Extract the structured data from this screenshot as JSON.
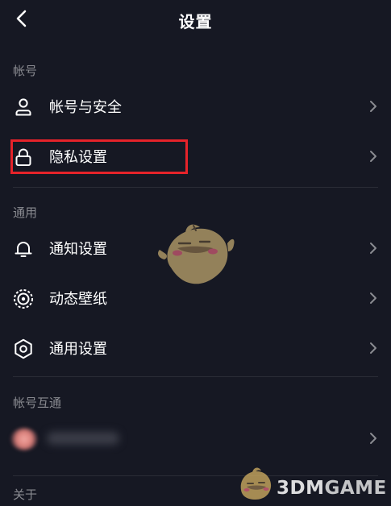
{
  "header": {
    "title": "设置"
  },
  "sections": {
    "account": {
      "label": "帐号",
      "items": [
        {
          "label": "帐号与安全",
          "icon": "person-icon"
        },
        {
          "label": "隐私设置",
          "icon": "lock-icon"
        }
      ]
    },
    "general": {
      "label": "通用",
      "items": [
        {
          "label": "通知设置",
          "icon": "bell-icon"
        },
        {
          "label": "动态壁纸",
          "icon": "live-wallpaper-icon"
        },
        {
          "label": "通用设置",
          "icon": "gear-icon"
        }
      ]
    },
    "interop": {
      "label": "帐号互通"
    },
    "about": {
      "label": "关于"
    }
  },
  "watermark": {
    "brand_number": "3DM",
    "brand_text": "GAME"
  },
  "colors": {
    "background": "#161823",
    "highlight_border": "#e6232a",
    "section_label": "#8a8b91"
  }
}
